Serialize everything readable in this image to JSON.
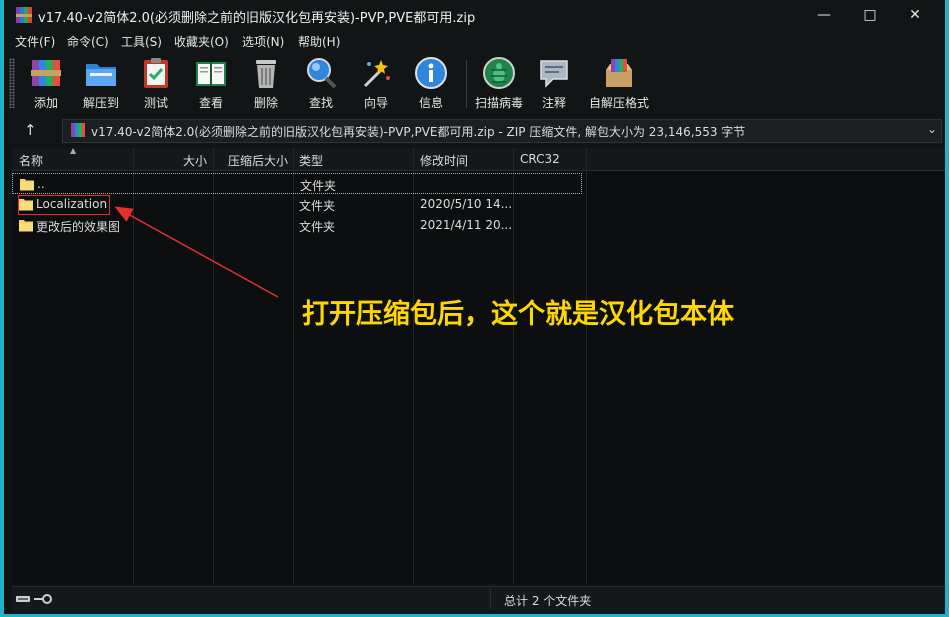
{
  "window": {
    "title": "v17.40-v2简体2.0(必须删除之前的旧版汉化包再安装)-PVP,PVE都可用.zip",
    "minimize_glyph": "—",
    "restore_glyph": "□",
    "close_glyph": "✕"
  },
  "menu": [
    "文件(F)",
    "命令(C)",
    "工具(S)",
    "收藏夹(O)",
    "选项(N)",
    "帮助(H)"
  ],
  "toolbar": [
    {
      "label": "添加",
      "icon": "add-books-icon"
    },
    {
      "label": "解压到",
      "icon": "extract-folder-icon"
    },
    {
      "label": "测试",
      "icon": "test-clipboard-icon"
    },
    {
      "label": "查看",
      "icon": "view-book-icon"
    },
    {
      "label": "删除",
      "icon": "trash-icon"
    },
    {
      "label": "查找",
      "icon": "magnifier-icon"
    },
    {
      "label": "向导",
      "icon": "wizard-wand-icon"
    },
    {
      "label": "信息",
      "icon": "info-icon"
    },
    {
      "label": "扫描病毒",
      "icon": "virus-scan-icon"
    },
    {
      "label": "注释",
      "icon": "comment-icon"
    },
    {
      "label": "自解压格式",
      "icon": "sfx-box-icon"
    }
  ],
  "address": {
    "up_glyph": "↑",
    "text": "v17.40-v2简体2.0(必须删除之前的旧版汉化包再安装)-PVP,PVE都可用.zip - ZIP 压缩文件, 解包大小为 23,146,553 字节",
    "dropdown_glyph": "⌄"
  },
  "columns": [
    "名称",
    "大小",
    "压缩后大小",
    "类型",
    "修改时间",
    "CRC32"
  ],
  "rows": [
    {
      "name": "..",
      "size": "",
      "packed": "",
      "type": "文件夹",
      "modified": "",
      "crc": ""
    },
    {
      "name": "Localization",
      "size": "",
      "packed": "",
      "type": "文件夹",
      "modified": "2020/5/10 14...",
      "crc": ""
    },
    {
      "name": "更改后的效果图",
      "size": "",
      "packed": "",
      "type": "文件夹",
      "modified": "2021/4/11 20...",
      "crc": ""
    }
  ],
  "annotation": "打开压缩包后，这个就是汉化包本体",
  "status": {
    "summary": "总计 2 个文件夹"
  },
  "colors": {
    "accent_border": "#1fb3c6",
    "annotation_text": "#ffd700",
    "annotation_arrow": "#e03030",
    "folder": "#f5d36b"
  }
}
